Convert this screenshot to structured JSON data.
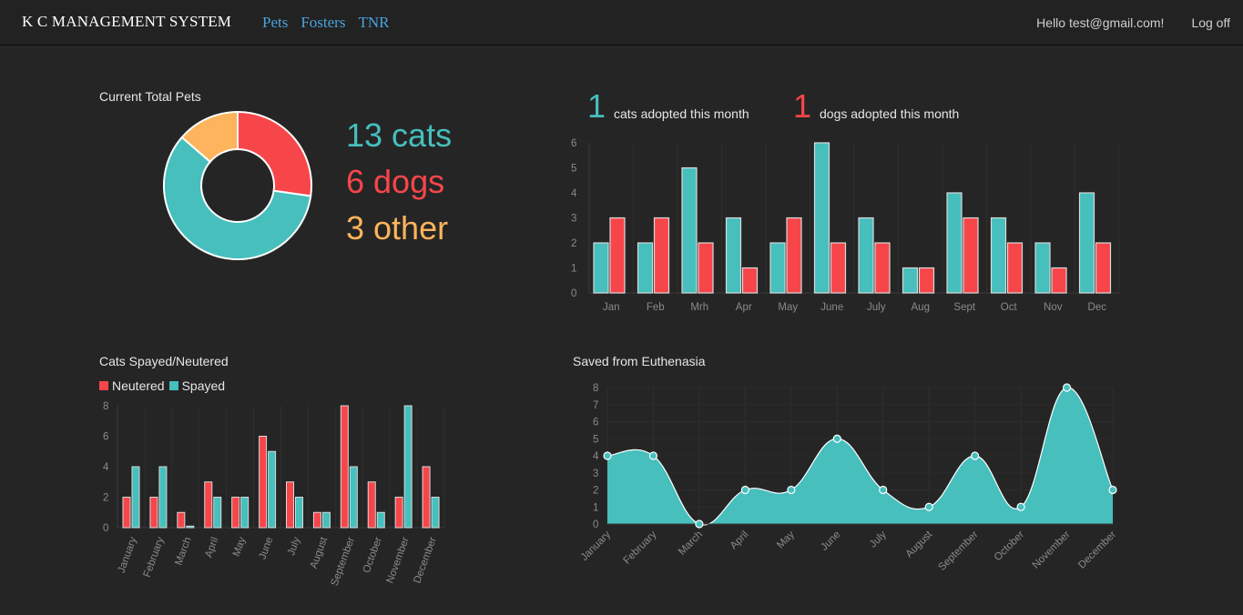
{
  "nav": {
    "brand": "K C MANAGEMENT SYSTEM",
    "links": [
      "Pets",
      "Fosters",
      "TNR"
    ],
    "greeting": "Hello test@gmail.com!",
    "logoff": "Log off"
  },
  "totals": {
    "title": "Current Total Pets",
    "cats_text": "13 cats",
    "dogs_text": "6 dogs",
    "other_text": "3 other"
  },
  "adoptions": {
    "cats_count": "1",
    "cats_label": "cats adopted this month",
    "dogs_count": "1",
    "dogs_label": "dogs adopted this month"
  },
  "spay": {
    "title": "Cats Spayed/Neutered",
    "legend": [
      "Neutered",
      "Spayed"
    ]
  },
  "saved": {
    "title": "Saved from Euthenasia"
  },
  "colors": {
    "cats": "#46bfbd",
    "dogs": "#f7464a",
    "other": "#fdb45c",
    "navlink": "#4aa3df"
  },
  "chart_data": [
    {
      "type": "pie",
      "categories": [
        "cats",
        "dogs",
        "other"
      ],
      "values": [
        13,
        6,
        3
      ]
    },
    {
      "type": "bar",
      "categories": [
        "Jan",
        "Feb",
        "Mrh",
        "Apr",
        "May",
        "June",
        "July",
        "Aug",
        "Sept",
        "Oct",
        "Nov",
        "Dec"
      ],
      "series": [
        {
          "values": [
            2,
            2,
            5,
            3,
            2,
            6,
            3,
            1,
            4,
            3,
            2,
            4
          ]
        },
        {
          "values": [
            3,
            3,
            2,
            1,
            3,
            2,
            2,
            1,
            3,
            2,
            1,
            2
          ]
        }
      ],
      "ylim": [
        0,
        6
      ],
      "yticks": [
        0,
        1,
        2,
        3,
        4,
        5,
        6
      ]
    },
    {
      "type": "bar",
      "categories": [
        "January",
        "February",
        "March",
        "April",
        "May",
        "June",
        "July",
        "August",
        "September",
        "October",
        "November",
        "December"
      ],
      "series": [
        {
          "name": "Neutered",
          "values": [
            2,
            2,
            1,
            3,
            2,
            6,
            3,
            1,
            8,
            3,
            2,
            4
          ]
        },
        {
          "name": "Spayed",
          "values": [
            4,
            4,
            0.1,
            2,
            2,
            5,
            2,
            1,
            4,
            1,
            8,
            2
          ]
        }
      ],
      "ylim": [
        0,
        8
      ],
      "yticks": [
        0,
        2,
        4,
        6,
        8
      ]
    },
    {
      "type": "area",
      "categories": [
        "January",
        "February",
        "March",
        "April",
        "May",
        "June",
        "July",
        "August",
        "September",
        "October",
        "November",
        "December"
      ],
      "values": [
        4,
        4,
        0,
        2,
        2,
        5,
        2,
        1,
        4,
        1,
        8,
        2
      ],
      "ylim": [
        0,
        8
      ],
      "yticks": [
        0,
        1,
        2,
        3,
        4,
        5,
        6,
        7,
        8
      ]
    }
  ]
}
